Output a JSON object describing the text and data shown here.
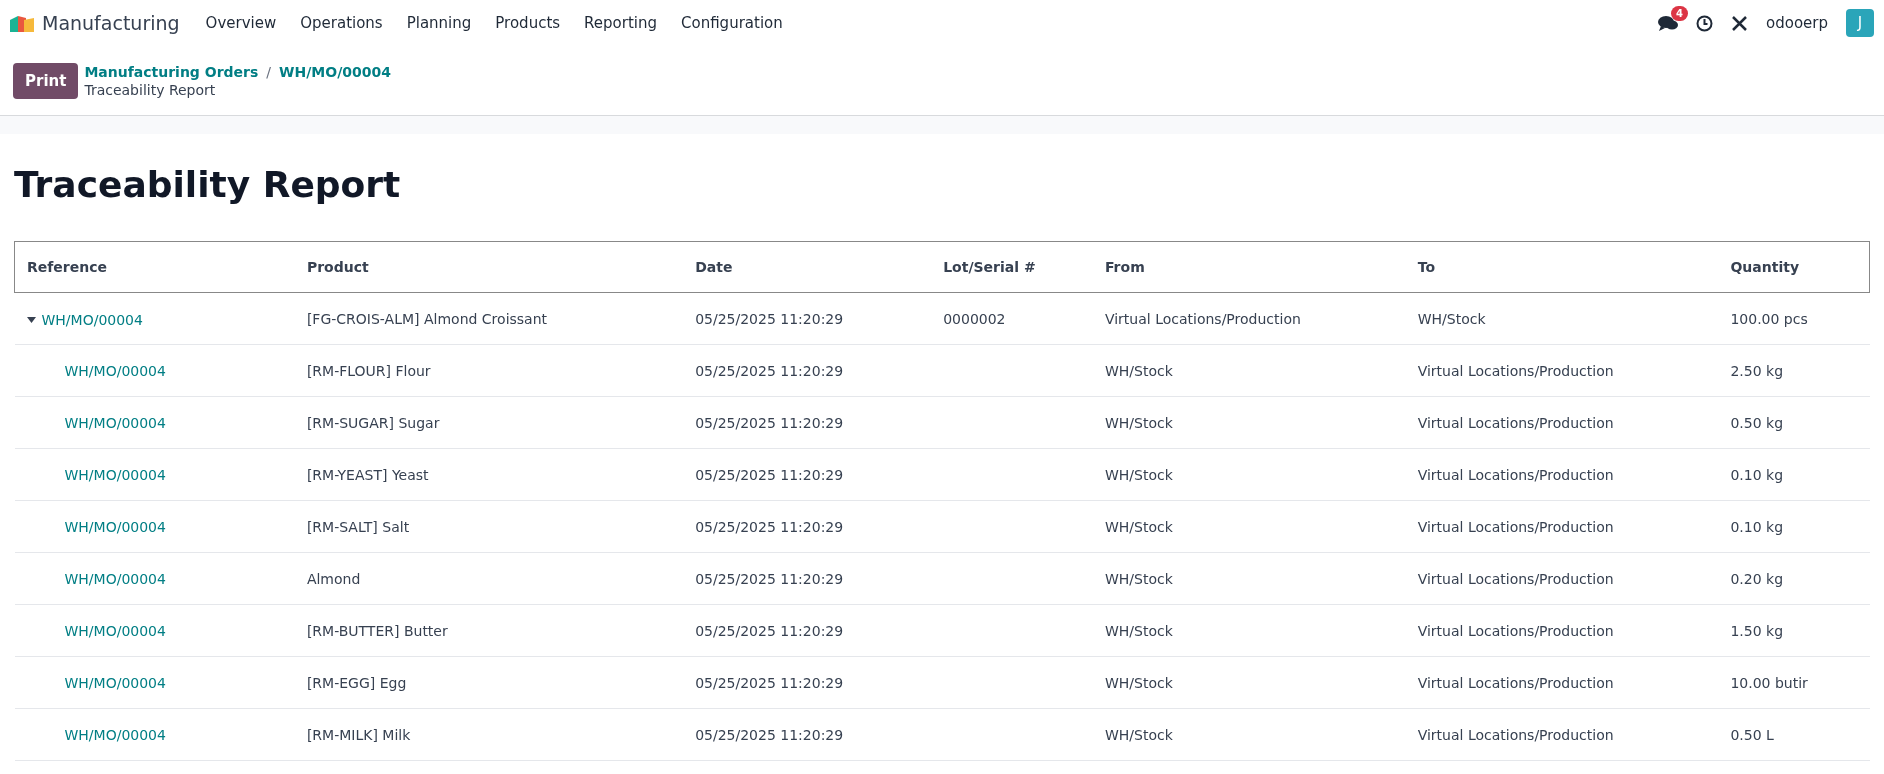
{
  "navbar": {
    "app_name": "Manufacturing",
    "menu": [
      "Overview",
      "Operations",
      "Planning",
      "Products",
      "Reporting",
      "Configuration"
    ],
    "messages_badge": "4",
    "company": "odooerp",
    "avatar_letter": "J"
  },
  "control_panel": {
    "print_button": "Print",
    "breadcrumbs": [
      "Manufacturing Orders",
      "WH/MO/00004"
    ],
    "separator": "/",
    "current": "Traceability Report"
  },
  "report": {
    "title": "Traceability Report",
    "columns": [
      "Reference",
      "Product",
      "Date",
      "Lot/Serial #",
      "From",
      "To",
      "Quantity"
    ],
    "rows": [
      {
        "reference": "WH/MO/00004",
        "product": "[FG-CROIS-ALM] Almond Croissant",
        "date": "05/25/2025 11:20:29",
        "lot": "0000002",
        "from": "Virtual Locations/Production",
        "to": "WH/Stock",
        "quantity": "100.00 pcs",
        "expanded": true,
        "children": [
          {
            "reference": "WH/MO/00004",
            "product": "[RM-FLOUR] Flour",
            "date": "05/25/2025 11:20:29",
            "from": "WH/Stock",
            "to": "Virtual Locations/Production",
            "quantity": "2.50 kg"
          },
          {
            "reference": "WH/MO/00004",
            "product": "[RM-SUGAR] Sugar",
            "date": "05/25/2025 11:20:29",
            "from": "WH/Stock",
            "to": "Virtual Locations/Production",
            "quantity": "0.50 kg"
          },
          {
            "reference": "WH/MO/00004",
            "product": "[RM-YEAST] Yeast",
            "date": "05/25/2025 11:20:29",
            "from": "WH/Stock",
            "to": "Virtual Locations/Production",
            "quantity": "0.10 kg"
          },
          {
            "reference": "WH/MO/00004",
            "product": "[RM-SALT] Salt",
            "date": "05/25/2025 11:20:29",
            "from": "WH/Stock",
            "to": "Virtual Locations/Production",
            "quantity": "0.10 kg"
          },
          {
            "reference": "WH/MO/00004",
            "product": "Almond",
            "date": "05/25/2025 11:20:29",
            "from": "WH/Stock",
            "to": "Virtual Locations/Production",
            "quantity": "0.20 kg"
          },
          {
            "reference": "WH/MO/00004",
            "product": "[RM-BUTTER] Butter",
            "date": "05/25/2025 11:20:29",
            "from": "WH/Stock",
            "to": "Virtual Locations/Production",
            "quantity": "1.50 kg"
          },
          {
            "reference": "WH/MO/00004",
            "product": "[RM-EGG] Egg",
            "date": "05/25/2025 11:20:29",
            "from": "WH/Stock",
            "to": "Virtual Locations/Production",
            "quantity": "10.00 butir"
          },
          {
            "reference": "WH/MO/00004",
            "product": "[RM-MILK] Milk",
            "date": "05/25/2025 11:20:29",
            "from": "WH/Stock",
            "to": "Virtual Locations/Production",
            "quantity": "0.50 L"
          }
        ]
      }
    ]
  }
}
